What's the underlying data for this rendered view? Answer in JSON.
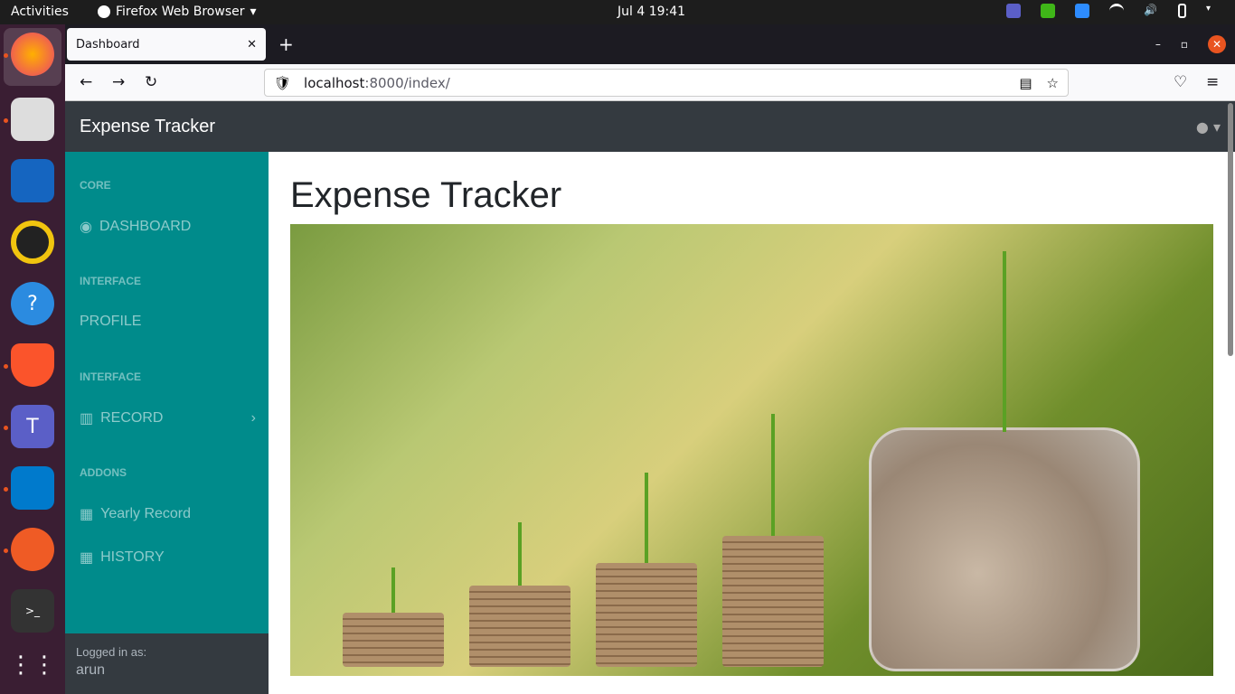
{
  "system": {
    "activities": "Activities",
    "app_name": "Firefox Web Browser",
    "clock": "Jul 4  19:41"
  },
  "browser": {
    "tab_title": "Dashboard",
    "url_host": "localhost",
    "url_rest": ":8000/index/"
  },
  "site": {
    "brand": "Expense Tracker",
    "page_title": "Expense Tracker"
  },
  "sidebar": {
    "sections": [
      {
        "heading": "CORE",
        "items": [
          {
            "label": "DASHBOARD",
            "icon": "tachometer-icon"
          }
        ]
      },
      {
        "heading": "INTERFACE",
        "items": [
          {
            "label": "PROFILE",
            "icon": ""
          }
        ]
      },
      {
        "heading": "INTERFACE",
        "items": [
          {
            "label": "RECORD",
            "icon": "book-open-icon"
          }
        ]
      },
      {
        "heading": "ADDONS",
        "items": [
          {
            "label": "Yearly Record",
            "icon": "table-icon"
          },
          {
            "label": "HISTORY",
            "icon": "table-icon"
          }
        ]
      }
    ],
    "footer_label": "Logged in as:",
    "footer_user": "arun"
  },
  "colors": {
    "sidebar_bg": "#008b8b",
    "nav_bg": "#343a40",
    "accent": "#e95420"
  }
}
